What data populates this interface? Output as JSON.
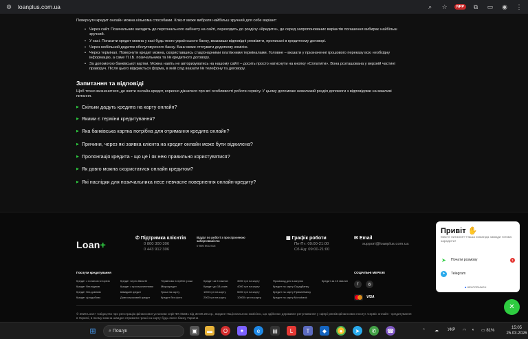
{
  "browser": {
    "url": "loanplus.com.ua",
    "ext_badge": "NPP"
  },
  "content": {
    "intro": "Повернути кредит онлайн можна кількома способами. Клієнт може вибрати найбільш зручний для себе варіант:",
    "bullets": [
      "Через сайт. Позичальник заходить до персонального кабінету на сайті, переходить до розділу «Кредити», де серед запропонованих варіантів погашення вибирає найбільш зручний.",
      "У касі. Погасити кредит можна у касі будь-якого українського банку, вказавши відповідні реквізити, прописані в кредитному договорі.",
      "Через мобільний додаток обслуговуючого банку. Банк може стягувати додаткову комісію.",
      "Через термінал. Повернути кредит можна, скориставшись стаціонарними платіжними терміналами. Головне – вказати у призначенні грошового переказу всю необхідну інформацію, а саме П.І.Б. позичальника та № кредитного договору.",
      "За допомогою банківської картки. Можна навіть не авторизуватись на нашому сайті – досить просто натиснути на кнопку «Сплатити». Вона розташована у верхній частині праворуч. Після цього відкриється форма, в якій слід вказати № телефону та договору."
    ],
    "faq_title": "Запитання та відповіді",
    "faq_intro": "Щоб точно визначитися, де взяти онлайн-кредит, корисно дізнатися про всі особливості роботи сервісу. У цьому допоможе невеликий розділ допомоги з відповідями на важливі питання.",
    "faq": [
      "Скільки дадуть кредита на карту онлайн?",
      "Якими є терміни кредитування?",
      "Яка банківська картка потрібна для отримання кредита онлайн?",
      "Причини, через які заявка клієнта на кредит онлайн може бути відхилена?",
      "Пролонгація кредита - що це і як нею правильно користуватися?",
      "Як довго можна скористатися онлайн кредитом?",
      "Які наслідки для позичальника несе невчасне повернення онлайн-кредиту?"
    ]
  },
  "footer": {
    "logo": "Loan",
    "logo_plus": "+",
    "support_title": "Підтримка клієнтів",
    "phone1": "0 800 300 306",
    "phone2": "0 443 912 306",
    "dept_title": "Відділ по роботі з простроченою заборгованістю",
    "dept_phone": "0 800 801 815",
    "hours_title": "Графік роботи",
    "hours1": "Пн-Пт: 09:00-21:00",
    "hours2": "Сб-Нд: 09:00-21:00",
    "email_title": "Email",
    "email": "support@loanplus.com.ua",
    "services_title": "Послуги кредитування",
    "social_title": "СОЦІАЛЬНІ МЕРЕЖІ",
    "link_cols": [
      [
        "Кредит з поганою історією",
        "Кредит без відмов",
        "Кредит без дзвінків",
        "Кредит цілодобово"
      ],
      [
        "Кредит через банк ID",
        "Кредит з простроченнями",
        "Швидкий кредит",
        "Довгостроковий кредит"
      ],
      [
        "Терміново потрібні гроші",
        "Мікрокредит",
        "Гроші на карту",
        "Кредит без фото"
      ],
      [
        "Кредит за 5 хвилин",
        "Кредит до 18 років",
        "1000 грн на карту",
        "2000 грн на карту"
      ],
      [
        "3000 грн на карту",
        "4000 грн на карту",
        "5000 грн на карту",
        "10000 грн на карту"
      ],
      [
        "Промокод для Loanplus",
        "Кредит на карту Ощадбанку",
        "Кредит на карту ПриватБанку",
        "Кредит на карту Monobank"
      ],
      [
        "Кредит за 15 хвилин"
      ]
    ],
    "copyright": "© 2026 Loan+ Свідоцтво про реєстрацію фінансової установи серії ФК №581 від 30.09.2014р., видане Національною комісією, що здійснює державне регулювання у сфері ринків фінансових послуг. Сервіс онлайн - кредитування в Україні, в якому можна швидко отримати гроші на карту будь-якого банку України."
  },
  "widget": {
    "title": "Привіт",
    "subtitle": "Маєте питання? Наша команда завжди готова зарадити!",
    "row1": "Почати розмову",
    "row1_badge": "1",
    "row2": "Telegram",
    "powered": "HELPCRUNCH"
  },
  "taskbar": {
    "search_placeholder": "Пошук",
    "lang": "УКР",
    "battery": "81%",
    "time": "15:05",
    "date": "25.03.2026"
  }
}
